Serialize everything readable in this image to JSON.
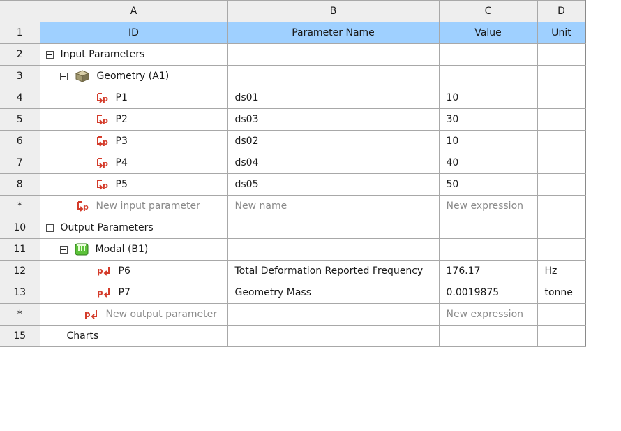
{
  "columns": [
    "A",
    "B",
    "C",
    "D"
  ],
  "header_row": {
    "num": "1",
    "id": "ID",
    "name": "Parameter Name",
    "value": "Value",
    "unit": "Unit"
  },
  "input_group": {
    "num": "2",
    "label": "Input Parameters"
  },
  "geometry": {
    "num": "3",
    "label": "Geometry (A1)"
  },
  "input_params": [
    {
      "num": "4",
      "id": "P1",
      "name": "ds01",
      "value": "10",
      "unit": ""
    },
    {
      "num": "5",
      "id": "P2",
      "name": "ds03",
      "value": "30",
      "unit": ""
    },
    {
      "num": "6",
      "id": "P3",
      "name": "ds02",
      "value": "10",
      "unit": ""
    },
    {
      "num": "7",
      "id": "P4",
      "name": "ds04",
      "value": "40",
      "unit": ""
    },
    {
      "num": "8",
      "id": "P5",
      "name": "ds05",
      "value": "50",
      "unit": ""
    }
  ],
  "new_input": {
    "num": "*",
    "id": "New input parameter",
    "name": "New name",
    "value": "New expression"
  },
  "output_group": {
    "num": "10",
    "label": "Output Parameters"
  },
  "modal": {
    "num": "11",
    "label": "Modal (B1)"
  },
  "output_params": [
    {
      "num": "12",
      "id": "P6",
      "name": "Total Deformation Reported Frequency",
      "value": "176.17",
      "unit": "Hz"
    },
    {
      "num": "13",
      "id": "P7",
      "name": "Geometry Mass",
      "value": "0.0019875",
      "unit": "tonne"
    }
  ],
  "new_output": {
    "num": "*",
    "id": "New output parameter",
    "value": "New expression"
  },
  "charts": {
    "num": "15",
    "label": "Charts"
  },
  "icons": {
    "collapse": "minus-box-icon",
    "geometry": "geometry-cube-icon",
    "modal": "modal-system-icon",
    "input_param": "input-parameter-icon",
    "output_param": "output-parameter-icon"
  },
  "colors": {
    "header_bg": "#eeeeee",
    "title_row_bg": "#9fd0ff",
    "param_icon": "#d43b2a",
    "placeholder_text": "#8a8a8a"
  }
}
